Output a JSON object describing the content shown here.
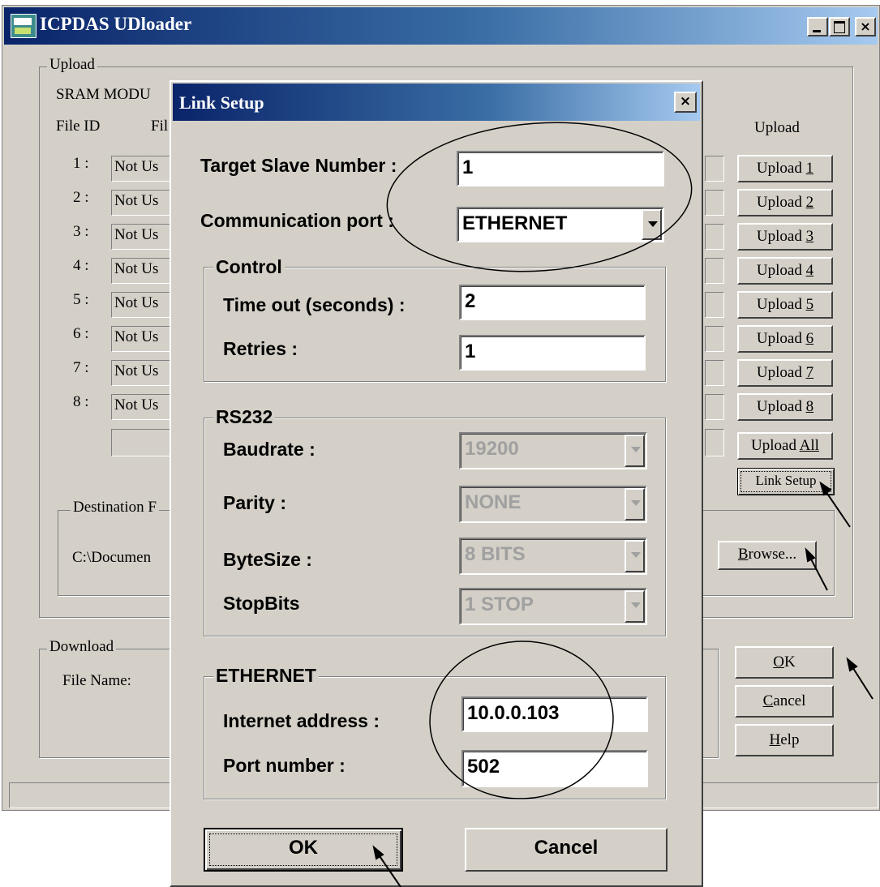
{
  "main": {
    "title": "ICPDAS UDloader",
    "upload_group": "Upload",
    "sram_label": "SRAM MODU",
    "col_file_id": "File ID",
    "col_fil": "Fil",
    "col_upload": "Upload",
    "rows": [
      {
        "id": "1 :",
        "value": "Not Us",
        "button": "Upload ",
        "key": "1"
      },
      {
        "id": "2 :",
        "value": "Not Us",
        "button": "Upload ",
        "key": "2"
      },
      {
        "id": "3 :",
        "value": "Not Us",
        "button": "Upload ",
        "key": "3"
      },
      {
        "id": "4 :",
        "value": "Not Us",
        "button": "Upload ",
        "key": "4"
      },
      {
        "id": "5 :",
        "value": "Not Us",
        "button": "Upload ",
        "key": "5"
      },
      {
        "id": "6 :",
        "value": "Not Us",
        "button": "Upload ",
        "key": "6"
      },
      {
        "id": "7 :",
        "value": "Not Us",
        "button": "Upload ",
        "key": "7"
      },
      {
        "id": "8 :",
        "value": "Not Us",
        "button": "Upload ",
        "key": "8"
      }
    ],
    "upload_all": "Upload ",
    "upload_all_key": "All",
    "link_setup": "Link Setup",
    "destination_group": "Destination F",
    "destination_path": "C:\\Documen",
    "browse_key": "B",
    "browse_rest": "rowse...",
    "download_group": "Download",
    "file_name_label": "File Name:",
    "ok_key": "O",
    "ok_rest": "K",
    "cancel_key": "C",
    "cancel_rest": "ancel",
    "help_key": "H",
    "help_rest": "elp"
  },
  "dialog": {
    "title": "Link Setup",
    "close": "×",
    "target_slave_label": "Target Slave Number :",
    "target_slave_value": "1",
    "comm_port_label": "Communication port :",
    "comm_port_value": "ETHERNET",
    "control_group": "Control",
    "timeout_label": "Time out (seconds) :",
    "timeout_value": "2",
    "retries_label": "Retries :",
    "retries_value": "1",
    "rs232_group": "RS232",
    "baudrate_label": "Baudrate :",
    "baudrate_value": "19200",
    "parity_label": "Parity :",
    "parity_value": "NONE",
    "bytesize_label": "ByteSize :",
    "bytesize_value": "8 BITS",
    "stopbits_label": "StopBits",
    "stopbits_value": "1 STOP",
    "ethernet_group": "ETHERNET",
    "ip_label": "Internet address :",
    "ip_value": "10.0.0.103",
    "port_label": "Port number :",
    "port_value": "502",
    "ok": "OK",
    "cancel": "Cancel"
  }
}
